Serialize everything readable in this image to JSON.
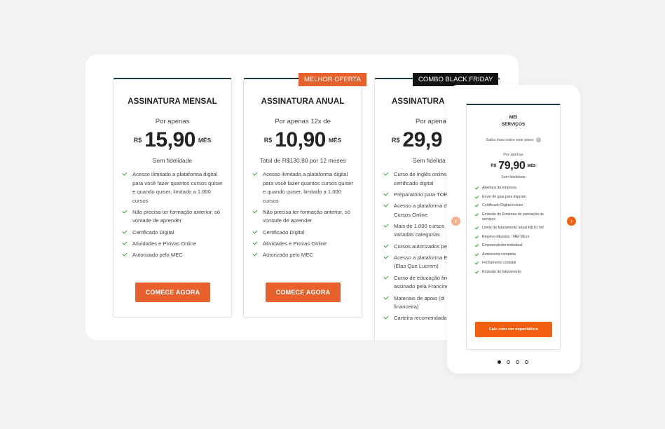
{
  "desktop": {
    "plans": [
      {
        "title": "ASSINATURA MENSAL",
        "per": "Por apenas",
        "currency": "R$",
        "amount": "15,90",
        "unit": "MÊS",
        "subtitle": "Sem fidelidade",
        "features": [
          "Acesso ilimitado a plataforma digital para você fazer quantos cursos quiser e quando quiser, limitado a 1.000 cursos",
          "Não precisa ter formação anterior, só vontade de aprender",
          "Certificado Digital",
          "Atividades e Provas Online",
          "Autorizado pelo MEC"
        ],
        "cta": "COMECE AGORA"
      },
      {
        "badge": "MELHOR OFERTA",
        "title": "ASSINATURA ANUAL",
        "per": "Por apenas 12x de",
        "currency": "R$",
        "amount": "10,90",
        "unit": "MÊS",
        "subtitle": "Total de R$130,80 por 12 meses",
        "features": [
          "Acesso ilimitado a plataforma digital para você fazer quantos cursos quiser e quando quiser, limitado a 1.000 cursos",
          "Não precisa ter formação anterior, só vontade de aprender",
          "Certificado Digital",
          "Atividades e Provas Online",
          "Autorizado pelo MEC"
        ],
        "cta": "COMECE AGORA"
      },
      {
        "badge": "COMBO BLACK FRIDAY",
        "title": "ASSINATURA M",
        "per": "Por apena",
        "currency": "R$",
        "amount": "29,9",
        "subtitle": "Sem fidelida",
        "features": [
          "Curso de inglês online",
          "certificado digital",
          "Preparatório para TOE",
          "Acesso a plataforma d",
          "Cursos Online",
          "Mais de 1.000 cursos",
          "variadas categorias",
          "Cursos autorizados pe",
          "Acesso a plataforma E",
          "(Elas Que Lucrem)",
          "Curso de educação fin",
          "assinado pela Francine",
          "Materiais de apoio (di",
          "financeira)",
          "Carteira recomendada"
        ]
      }
    ]
  },
  "mobile": {
    "title_line1": "MEI",
    "title_line2": "SERVIÇOS",
    "info": "Saiba mais sobre este plano",
    "info_icon": "i",
    "per": "Por apenas",
    "currency": "R$",
    "amount": "79,90",
    "unit": "MÊS",
    "subtitle": "Sem fidelidade",
    "features": [
      "Abertura da empresa",
      "Envio de guia para imposto",
      "Certificado Digital incluso",
      "Emissão do Empresa de prestação de serviços",
      "Limite de faturamento anual R$ 81 mil",
      "Regime tributário - MEI Micro",
      "Empreendedor individual",
      "Assessoria completa",
      "Fechamento contábil",
      "Emissão do faturamento"
    ],
    "cta": "Fale com um especialista",
    "prev_arrow": "‹",
    "next_arrow": "›"
  },
  "colors": {
    "accent": "#e8612c",
    "accent_mobile": "#f2600f",
    "border_top": "#1f3a44",
    "check": "#3a9a3a"
  }
}
